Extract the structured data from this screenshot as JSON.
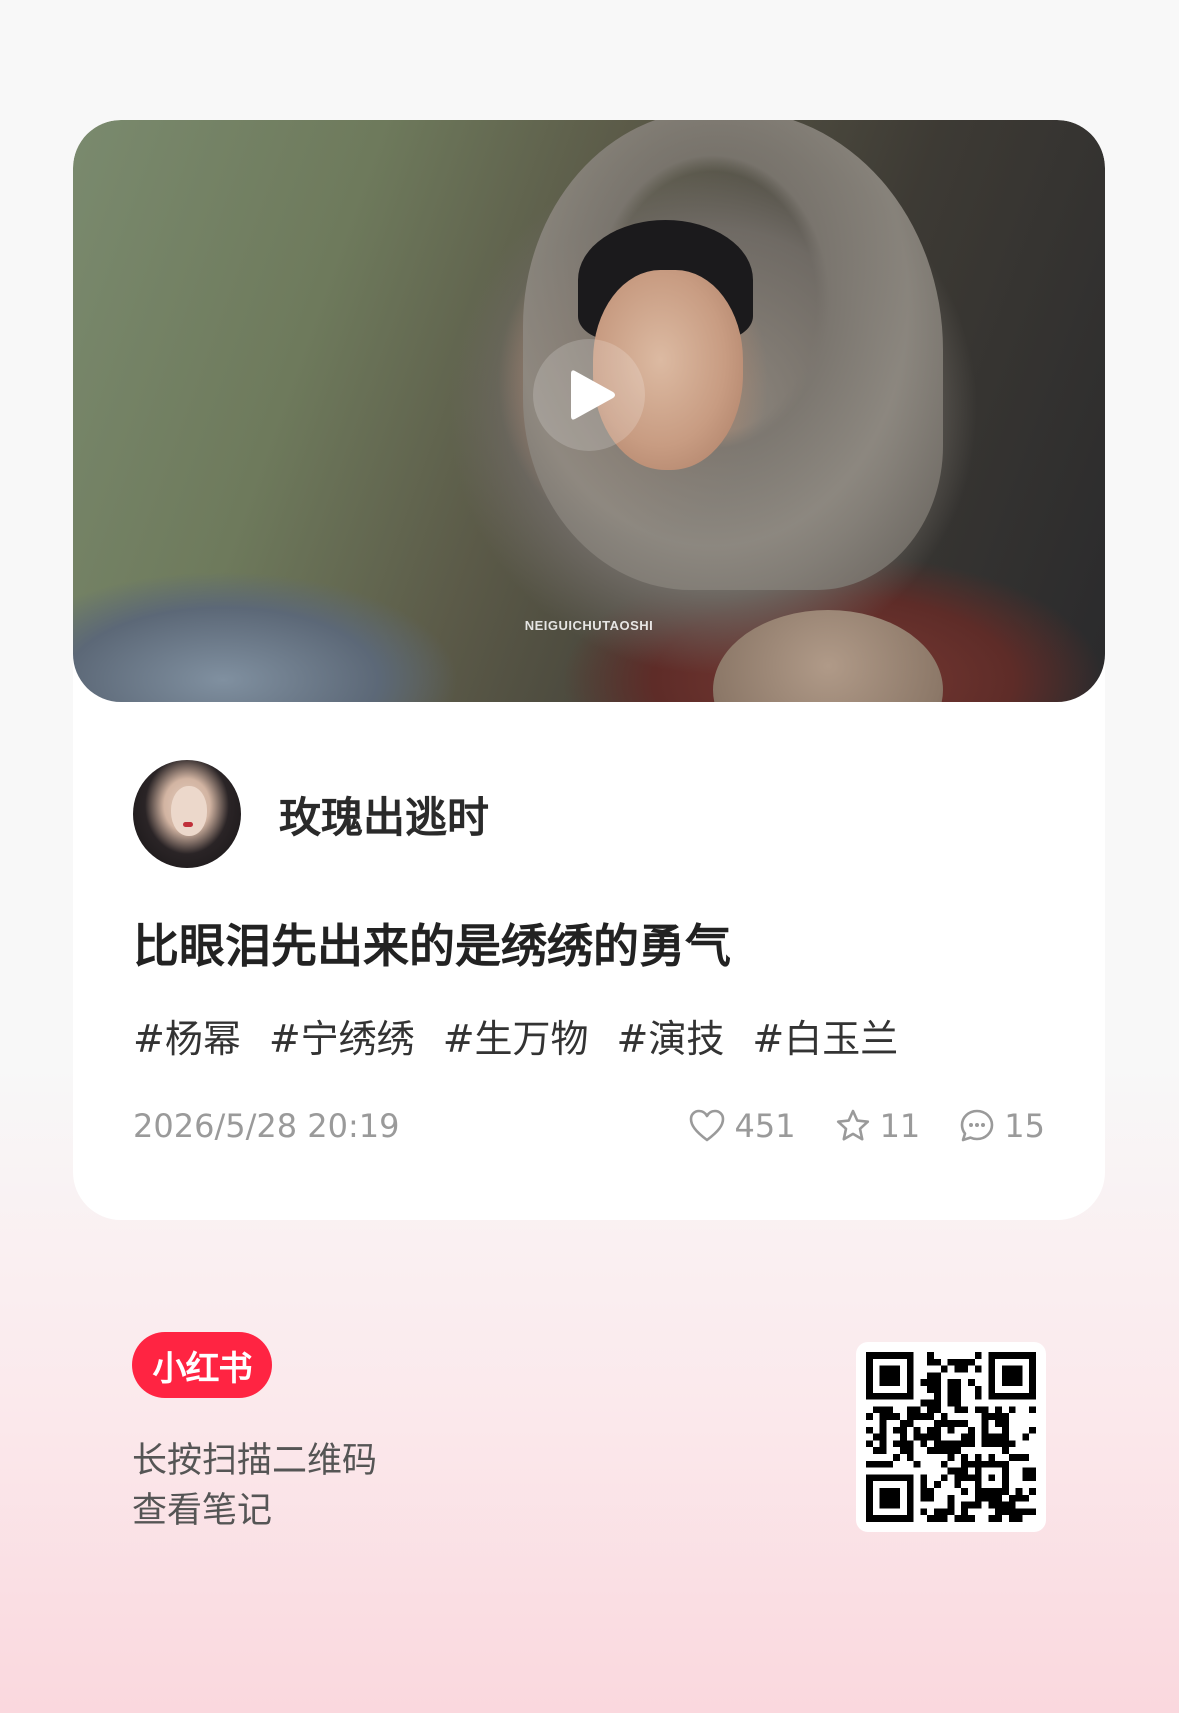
{
  "cover": {
    "watermark": "NEIGUICHUTAOSHI",
    "play_icon": "play-icon"
  },
  "author": {
    "name": "玫瑰出逃时",
    "avatar_icon": "avatar"
  },
  "note": {
    "title": "比眼泪先出来的是绣绣的勇气",
    "tags": [
      "#杨幂",
      "#宁绣绣",
      "#生万物",
      "#演技",
      "#白玉兰"
    ],
    "date": "2026/5/28 20:19"
  },
  "stats": {
    "likes": {
      "icon": "heart-icon",
      "count": "451"
    },
    "collects": {
      "icon": "star-icon",
      "count": "11"
    },
    "comments": {
      "icon": "comment-icon",
      "count": "15"
    }
  },
  "footer": {
    "brand": "小红书",
    "brand_color": "#ff2442",
    "hint_line1": "长按扫描二维码",
    "hint_line2": "查看笔记",
    "qr_icon": "qr-code"
  }
}
